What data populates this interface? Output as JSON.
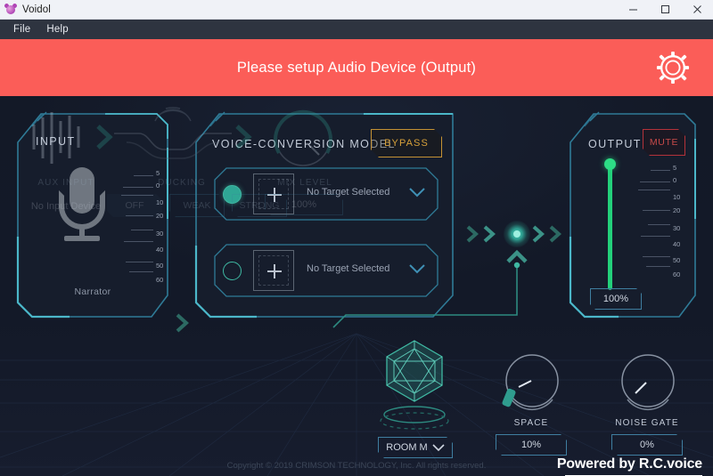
{
  "window": {
    "title": "Voidol",
    "app_icon": "voidol-app-icon",
    "controls": {
      "minimize": "minimize-icon",
      "maximize": "maximize-icon",
      "close": "close-icon"
    }
  },
  "menubar": {
    "items": [
      {
        "label": "File"
      },
      {
        "label": "Help"
      }
    ]
  },
  "banner": {
    "message": "Please setup Audio Device (Output)",
    "bg_color": "#fb5d58",
    "settings_icon": "gear-icon"
  },
  "input_panel": {
    "title": "INPUT",
    "device_name": "Narrator",
    "meter_scale": [
      "5",
      "0",
      "10",
      "20",
      "30",
      "40",
      "50",
      "60"
    ],
    "icon": "microphone-icon"
  },
  "model_panel": {
    "title": "VOICE-CONVERSION MODEL",
    "bypass_label": "BYPASS",
    "bypass_color": "#d6a03a",
    "targets": [
      {
        "text": "No Target Selected",
        "selected": true
      },
      {
        "text": "No Target Selected",
        "selected": false
      }
    ]
  },
  "output_panel": {
    "title": "OUTPUT",
    "mute_label": "MUTE",
    "mute_color": "#c84a4a",
    "volume_value": "100%",
    "volume_color": "#23d07a",
    "meter_scale": [
      "5",
      "0",
      "10",
      "20",
      "30",
      "40",
      "50",
      "60"
    ]
  },
  "bottom": {
    "aux_input": {
      "label": "AUX INPUT",
      "value": "No Input Device"
    },
    "ducking": {
      "label": "DUCKING",
      "options": [
        {
          "label": "OFF",
          "selected": true
        },
        {
          "label": "WEAK",
          "selected": false
        },
        {
          "label": "STRONG",
          "selected": false
        }
      ]
    },
    "mix_level": {
      "label": "MIX LEVEL",
      "value": "100%"
    },
    "room": {
      "value": "ROOM M"
    },
    "space": {
      "label": "SPACE",
      "value": "10%"
    },
    "noise_gate": {
      "label": "NOISE GATE",
      "value": "0%"
    }
  },
  "footer": {
    "copyright": "Copyright © 2019 CRIMSON TECHNOLOGY, Inc. All rights reserved.",
    "powered_by": "Powered by R.C.voice"
  },
  "theme": {
    "bg": "#131927",
    "accent_teal": "#3fb8a2",
    "panel_border": "#3f7ea0"
  }
}
